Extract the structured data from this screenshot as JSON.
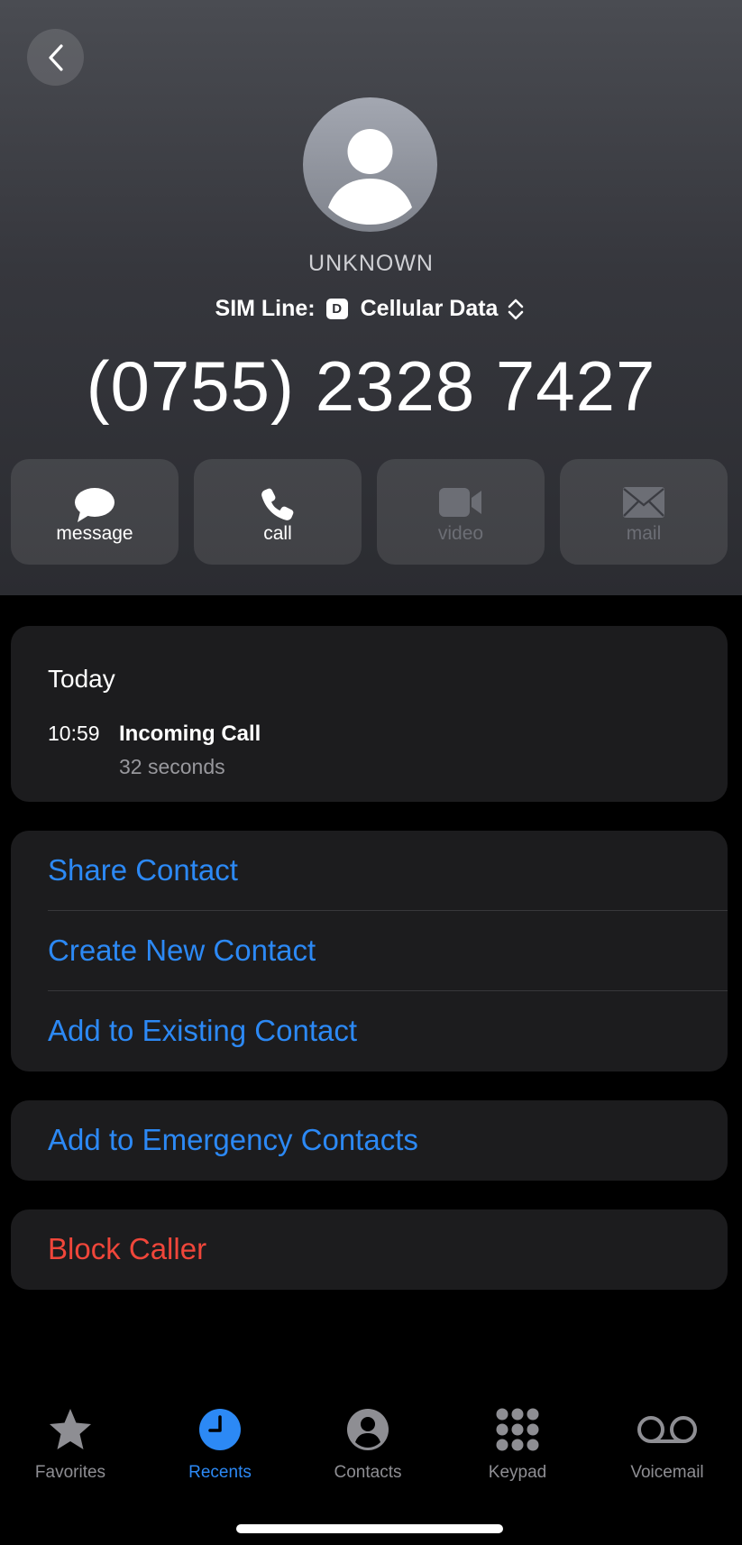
{
  "header": {
    "caller_name": "UNKNOWN",
    "sim_line_label": "SIM Line:",
    "sim_badge": "D",
    "sim_line_value": "Cellular Data",
    "phone_number": "(0755) 2328 7427"
  },
  "actions": [
    {
      "label": "message",
      "icon": "message-bubble-icon",
      "enabled": true
    },
    {
      "label": "call",
      "icon": "phone-icon",
      "enabled": true
    },
    {
      "label": "video",
      "icon": "video-camera-icon",
      "enabled": false
    },
    {
      "label": "mail",
      "icon": "envelope-icon",
      "enabled": false
    }
  ],
  "recents": {
    "day": "Today",
    "calls": [
      {
        "time": "10:59",
        "type": "Incoming Call",
        "duration": "32 seconds"
      }
    ]
  },
  "contact_actions": {
    "share": "Share Contact",
    "create": "Create New Contact",
    "add_existing": "Add to Existing Contact",
    "emergency": "Add to Emergency Contacts",
    "block": "Block Caller"
  },
  "tabbar": {
    "active": "Recents",
    "tabs": [
      {
        "label": "Favorites",
        "icon": "star-icon"
      },
      {
        "label": "Recents",
        "icon": "clock-icon"
      },
      {
        "label": "Contacts",
        "icon": "person-circle-icon"
      },
      {
        "label": "Keypad",
        "icon": "keypad-grid-icon"
      },
      {
        "label": "Voicemail",
        "icon": "voicemail-icon"
      }
    ]
  },
  "colors": {
    "accent_blue": "#2c89f5",
    "destructive_red": "#f0463a",
    "card_background": "#1c1c1e"
  }
}
